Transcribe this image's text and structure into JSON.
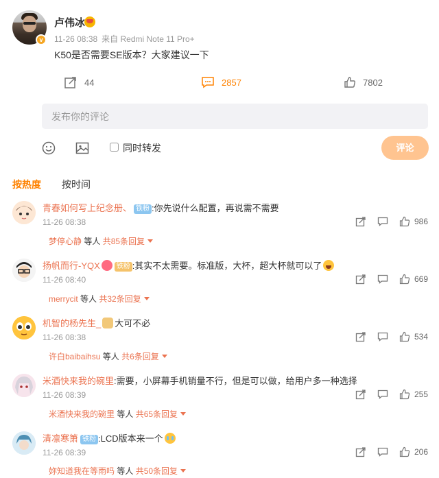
{
  "post": {
    "author": "卢伟冰",
    "date": "11-26 08:38",
    "source": "来自 Redmi Note 11 Pro+",
    "body": "K50是否需要SE版本？大家建议一下",
    "reposts": "44",
    "comments": "2857",
    "likes": "7802"
  },
  "composer": {
    "placeholder": "发布你的评论",
    "repost_label": "同时转发",
    "submit_label": "评论"
  },
  "sort": {
    "hot": "按热度",
    "time": "按时间"
  },
  "comments": [
    {
      "name": "青春如何写上纪念册、",
      "badge": "铁粉",
      "text": ":你先说什么配置，再说需不需要",
      "time": "11-26 08:38",
      "likes": "986",
      "reply_user": "梦停心静",
      "reply_mid": " 等人 ",
      "reply_count": "共85条回复"
    },
    {
      "name": "扬帆而行-YQX",
      "badge": "铁粉",
      "text": ":其实不太需要。标准版，大杯，超大杯就可以了",
      "time": "11-26 08:40",
      "likes": "669",
      "reply_user": "merrycit",
      "reply_mid": " 等人 ",
      "reply_count": "共32条回复"
    },
    {
      "name": "机智的杨先生_",
      "badge": "",
      "text": "大可不必",
      "time": "11-26 08:38",
      "likes": "534",
      "reply_user": "许白baibaihsu",
      "reply_mid": " 等人 ",
      "reply_count": "共6条回复"
    },
    {
      "name": "米酒快来我的碗里",
      "badge": "",
      "text": ":需要，小屏幕手机销量不行，但是可以做，给用户多一种选择",
      "time": "11-26 08:39",
      "likes": "255",
      "reply_user": "米酒快来我的碗里",
      "reply_mid": " 等人 ",
      "reply_count": "共65条回复"
    },
    {
      "name": "清凛寒箫",
      "badge": "铁粉",
      "text": ":LCD版本来一个",
      "time": "11-26 08:39",
      "likes": "206",
      "reply_user": "妳知道我在等雨吗",
      "reply_mid": " 等人 ",
      "reply_count": "共50条回复"
    }
  ],
  "colors": {
    "accent": "#ff8200",
    "username": "#eb7350",
    "submit_bg": "#ffc490",
    "fan_badge": "#8cc6f0"
  }
}
